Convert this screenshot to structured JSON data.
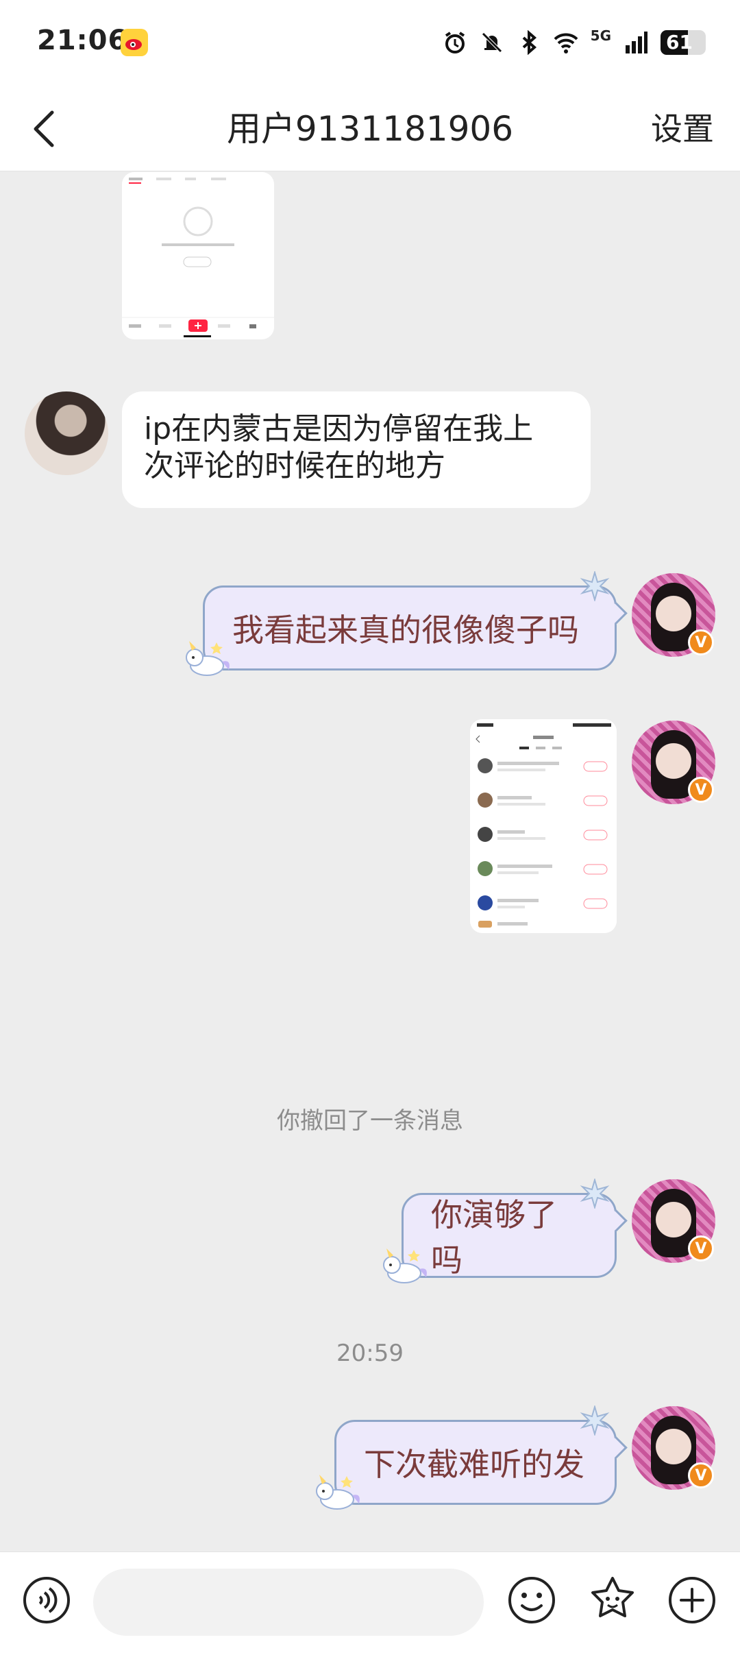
{
  "status_bar": {
    "time": "21:06",
    "network": "5G",
    "battery": "61",
    "battery_level": 0.61
  },
  "nav": {
    "title": "用户9131181906",
    "settings_label": "设置"
  },
  "messages": {
    "incoming_1_line1": "ip在内蒙古是因为停留在我上",
    "incoming_1_line2": "次评论的时候在的地方",
    "outgoing_1": "我看起来真的很像傻子吗",
    "system_1": "你撤回了一条消息",
    "outgoing_2": "你演够了吗",
    "timestamp_1": "20:59",
    "outgoing_3": "下次截难听的发"
  },
  "input": {
    "placeholder": ""
  },
  "colors": {
    "accent_red": "#ff2442",
    "bubble_out_bg": "#ede9fb",
    "bubble_out_text": "#7a3b3b",
    "badge_orange": "#f08a1c"
  }
}
